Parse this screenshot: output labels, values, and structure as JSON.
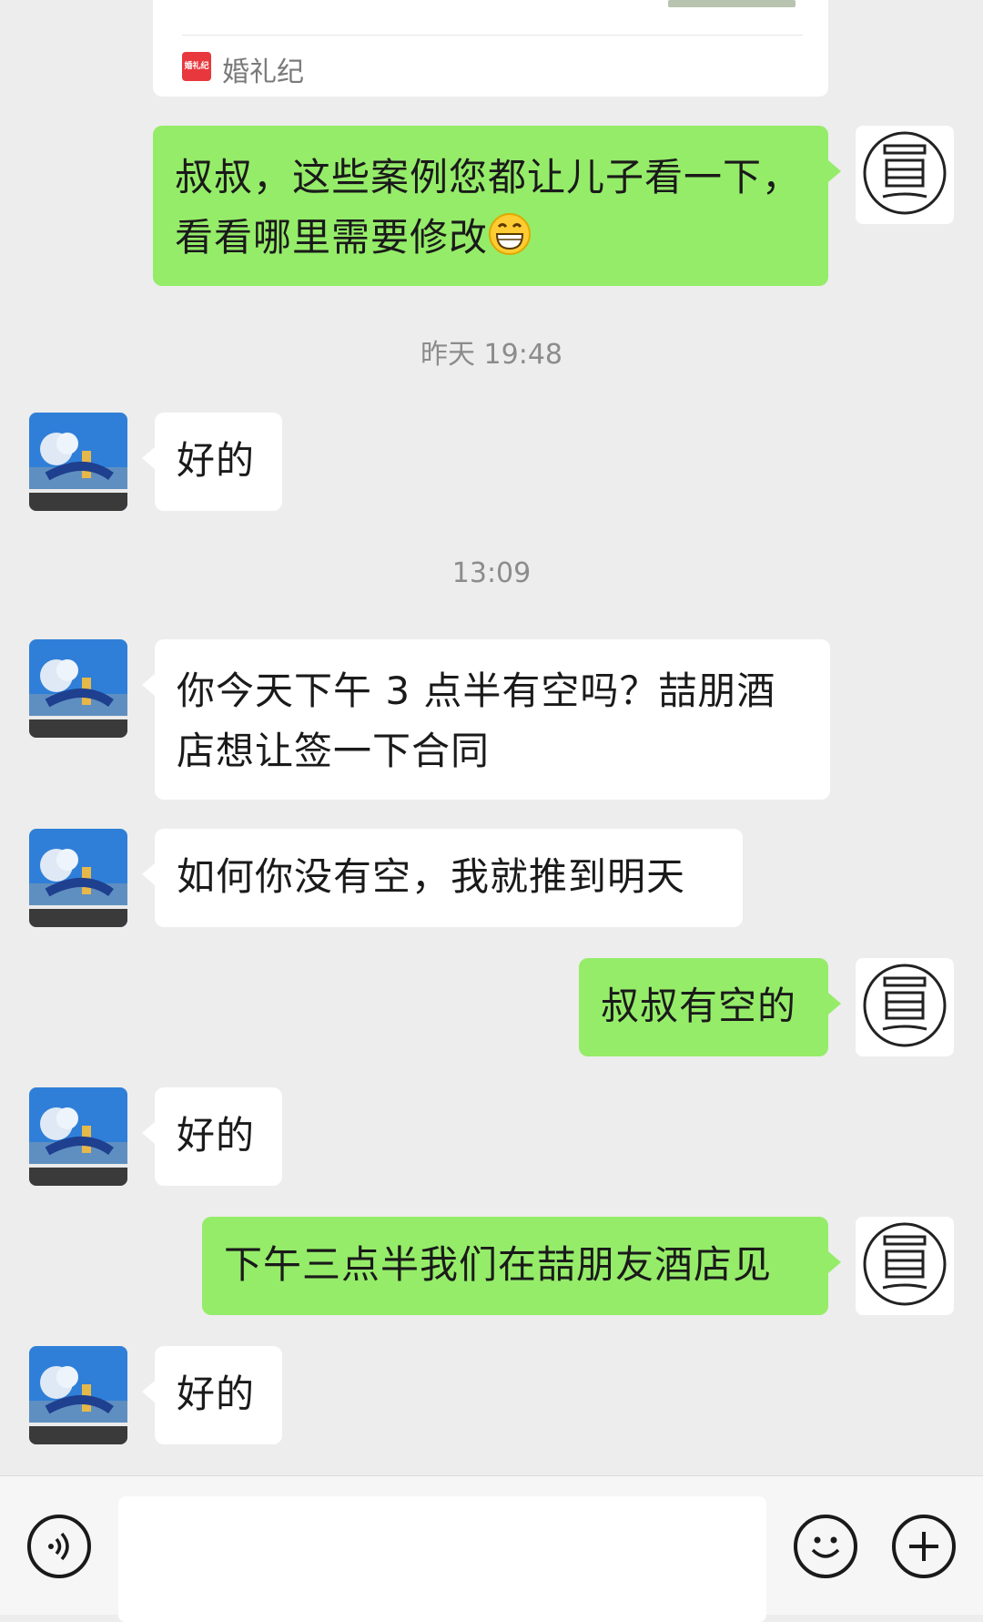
{
  "shared_card": {
    "source_icon_text": "婚礼纪",
    "source_name": "婚礼纪"
  },
  "messages": [
    {
      "id": "m1",
      "side": "out",
      "line1": "叔叔，这些案例您都让儿子看一下，",
      "line2": "看看哪里需要修改",
      "emoji": "grinning-face-emoji"
    },
    {
      "id": "ts1",
      "timestamp": "昨天 19:48"
    },
    {
      "id": "m2",
      "side": "in",
      "text": "好的"
    },
    {
      "id": "ts2",
      "timestamp": "13:09"
    },
    {
      "id": "m3",
      "side": "in",
      "line1": "你今天下午 3 点半有空吗？喆朋酒",
      "line2": "店想让签一下合同"
    },
    {
      "id": "m4",
      "side": "in",
      "text": "如何你没有空，我就推到明天"
    },
    {
      "id": "m5",
      "side": "out",
      "text": "叔叔有空的"
    },
    {
      "id": "m6",
      "side": "in",
      "text": "好的"
    },
    {
      "id": "m7",
      "side": "out",
      "text": "下午三点半我们在喆朋友酒店见"
    },
    {
      "id": "m8",
      "side": "in",
      "text": "好的"
    }
  ],
  "colors": {
    "background": "#ededed",
    "outgoing_bubble": "#95ec69",
    "incoming_bubble": "#ffffff",
    "timestamp_text": "#8c8c8c"
  },
  "bottom_bar": {
    "voice_icon": "voice-icon",
    "emoji_icon": "emoji-icon",
    "plus_icon": "plus-icon"
  }
}
